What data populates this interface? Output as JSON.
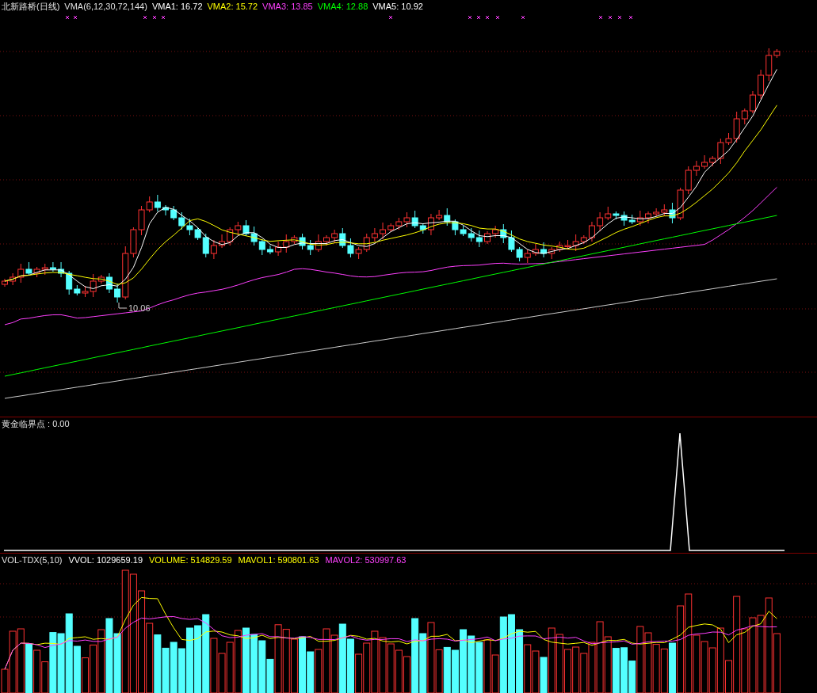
{
  "main": {
    "title": "北新路桥(日线)",
    "indicator": "VMA(6,12,30,72,144)",
    "low_label": "10.06",
    "values": [
      {
        "label": "VMA1: 16.72",
        "color": "#ffffff"
      },
      {
        "label": "VMA2: 15.72",
        "color": "#ffff00"
      },
      {
        "label": "VMA3: 13.85",
        "color": "#ff40ff"
      },
      {
        "label": "VMA4: 12.88",
        "color": "#00ff00"
      },
      {
        "label": "VMA5: 10.92",
        "color": "#ffffff"
      }
    ]
  },
  "signal": {
    "title": "黄金临界点 : 0.00"
  },
  "volume": {
    "title": "VOL-TDX(5,10)",
    "values": [
      {
        "label": "VVOL: 1029659.19",
        "color": "#ffffff"
      },
      {
        "label": "VOLUME: 514829.59",
        "color": "#ffff00"
      },
      {
        "label": "MAVOL1: 590801.63",
        "color": "#ffff00"
      },
      {
        "label": "MAVOL2: 530997.63",
        "color": "#ff40ff"
      }
    ]
  }
}
